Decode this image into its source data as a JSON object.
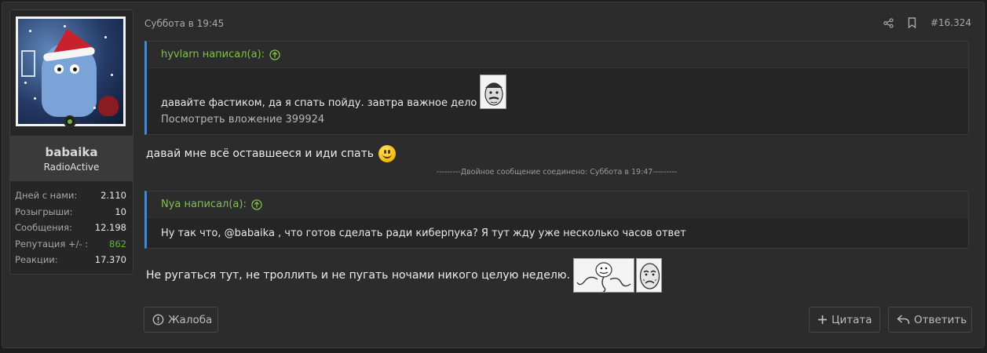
{
  "user": {
    "name": "babaika",
    "title": "RadioActive",
    "stats": [
      {
        "label": "Дней с нами:",
        "value": "2.110"
      },
      {
        "label": "Розыгрыши:",
        "value": "10"
      },
      {
        "label": "Сообщения:",
        "value": "12.198"
      },
      {
        "label": "Репутация +/- :",
        "value": "862"
      },
      {
        "label": "Реакции:",
        "value": "17.370"
      }
    ]
  },
  "post": {
    "date": "Суббота в 19:45",
    "number": "#16.324",
    "quote1": {
      "author": "hyvlarn написал(а):",
      "text": "давайте фастиком, да я спать пойду. завтра важное дело",
      "attachment": "Посмотреть вложение 399924"
    },
    "message1": "давай мне всё оставшееся и иди спать",
    "merged_notice": "---------Двойное сообщение соединено: Суббота в 19:47---------",
    "quote2": {
      "author": "Nya написал(а):",
      "text": "Ну так что, @babaika , что готов сделать ради киберпука? Я тут жду уже несколько часов ответ"
    },
    "message2": "Не ругаться тут, не троллить и не пугать ночами никого целую неделю."
  },
  "buttons": {
    "report": "Жалоба",
    "quote": "Цитата",
    "reply": "Ответить"
  },
  "colors": {
    "accent_green": "#7fc04e",
    "quote_border": "#4a86c8",
    "reputation_positive": "#63b33a"
  }
}
